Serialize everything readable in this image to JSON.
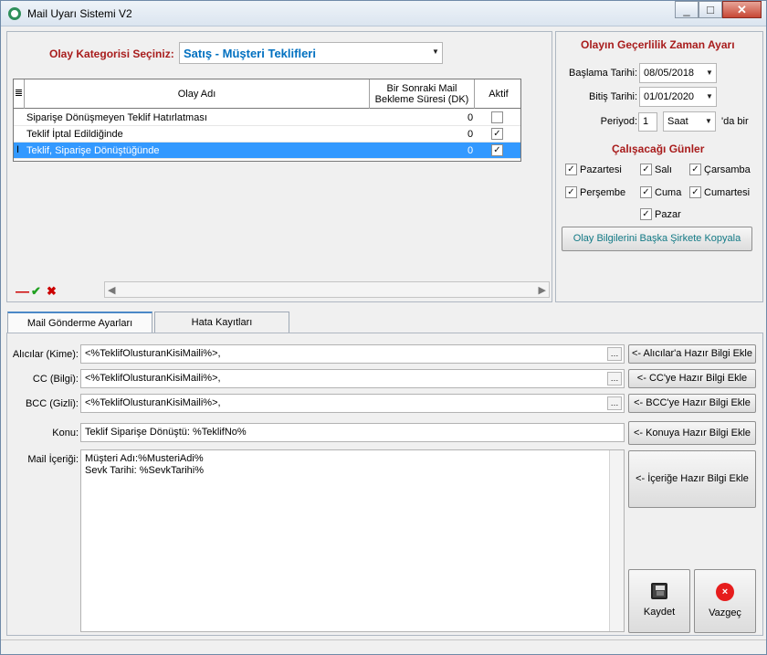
{
  "window": {
    "title": "Mail Uyarı Sistemi V2"
  },
  "category": {
    "label": "Olay Kategorisi Seçiniz:",
    "selected": "Satış - Müşteri Teklifleri"
  },
  "grid": {
    "headers": {
      "event": "Olay Adı",
      "wait": "Bir Sonraki Mail Bekleme Süresi (DK)",
      "active": "Aktif"
    },
    "rows": [
      {
        "event": "Siparişe Dönüşmeyen Teklif Hatırlatması",
        "wait": "0",
        "active": false
      },
      {
        "event": "Teklif İptal Edildiğinde",
        "wait": "0",
        "active": true
      },
      {
        "event": "Teklif, Siparişe Dönüştüğünde",
        "wait": "0",
        "active": true
      }
    ]
  },
  "validity": {
    "title": "Olayın Geçerlilik Zaman Ayarı",
    "start_label": "Başlama Tarihi:",
    "start_value": "08/05/2018",
    "end_label": "Bitiş Tarihi:",
    "end_value": "01/01/2020",
    "period_label": "Periyod:",
    "period_value": "1",
    "period_unit": "Saat",
    "period_suffix": "'da bir",
    "days_title": "Çalışacağı Günler",
    "days": [
      {
        "name": "Pazartesi",
        "checked": true
      },
      {
        "name": "Salı",
        "checked": true
      },
      {
        "name": "Çarsamba",
        "checked": true
      },
      {
        "name": "Perşembe",
        "checked": true
      },
      {
        "name": "Cuma",
        "checked": true
      },
      {
        "name": "Cumartesi",
        "checked": true
      },
      {
        "name": "Pazar",
        "checked": true
      }
    ],
    "copy_button": "Olay Bilgilerini Başka Şirkete Kopyala"
  },
  "tabs": {
    "mail": "Mail Gönderme Ayarları",
    "errors": "Hata Kayıtları"
  },
  "fields": {
    "to_label": "Alıcılar (Kime):",
    "to_value": "<%TeklifOlusturanKisiMaili%>,",
    "cc_label": "CC (Bilgi):",
    "cc_value": "<%TeklifOlusturanKisiMaili%>,",
    "bcc_label": "BCC (Gizli):",
    "bcc_value": "<%TeklifOlusturanKisiMaili%>,",
    "subject_label": "Konu:",
    "subject_value": "Teklif Siparişe Dönüştü: %TeklifNo%",
    "body_label": "Mail İçeriği:",
    "body_line1": "Müşteri Adı:%MusteriAdi%",
    "body_line2": "Sevk Tarihi: %SevkTarihi%"
  },
  "buttons": {
    "to_add": "<- Alıcılar'a Hazır Bilgi Ekle",
    "cc_add": "<- CC'ye Hazır Bilgi Ekle",
    "bcc_add": "<- BCC'ye Hazır Bilgi Ekle",
    "subject_add": "<- Konuya Hazır Bilgi Ekle",
    "body_add": "<- İçeriğe Hazır Bilgi Ekle",
    "save": "Kaydet",
    "cancel": "Vazgeç"
  },
  "colors": {
    "accent": "#0070c0",
    "label_red": "#a81c1c",
    "selection": "#3399ff"
  }
}
